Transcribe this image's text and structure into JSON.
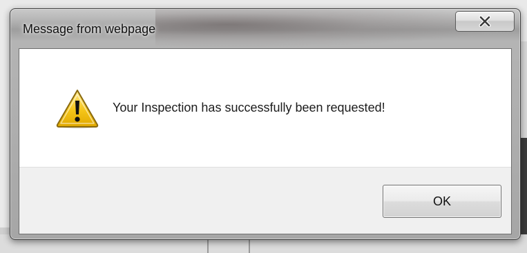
{
  "dialog": {
    "title": "Message from webpage",
    "close_icon": "close-icon",
    "message": "Your Inspection has successfully been requested!",
    "message_icon": "warning-icon",
    "ok_label": "OK"
  },
  "colors": {
    "warning_fill": "#f5c518",
    "warning_stroke": "#8a6a10"
  }
}
